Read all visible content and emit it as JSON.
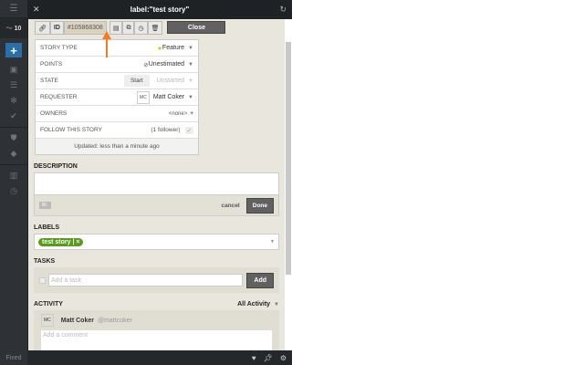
{
  "sidebar": {
    "velocity": "10",
    "fixed_label": "Fixed"
  },
  "header": {
    "title": "label:\"test story\""
  },
  "toolbar": {
    "id_label": "ID",
    "id_value": "#105868308",
    "close_label": "Close"
  },
  "fields": {
    "story_type": {
      "label": "STORY TYPE",
      "value": "Feature"
    },
    "points": {
      "label": "POINTS",
      "value": "Unestimated"
    },
    "state": {
      "label": "STATE",
      "button": "Start",
      "value": "Unstarted"
    },
    "requester": {
      "label": "REQUESTER",
      "initials": "MC",
      "value": "Matt Coker"
    },
    "owners": {
      "label": "OWNERS",
      "value": "<none>"
    },
    "follow": {
      "label": "FOLLOW THIS STORY",
      "value": "(1 follower)"
    },
    "updated": "Updated: less than a minute ago"
  },
  "description": {
    "title": "DESCRIPTION",
    "md": "M↓",
    "cancel": "cancel",
    "done": "Done"
  },
  "labels": {
    "title": "LABELS",
    "tag": "test story",
    "tag_remove": "×"
  },
  "tasks": {
    "title": "TASKS",
    "placeholder": "Add a task",
    "add": "Add"
  },
  "activity": {
    "title": "ACTIVITY",
    "filter": "All Activity",
    "initials": "MC",
    "user": "Matt Coker",
    "handle": "@mattcoker",
    "comment_placeholder": "Add a comment"
  }
}
